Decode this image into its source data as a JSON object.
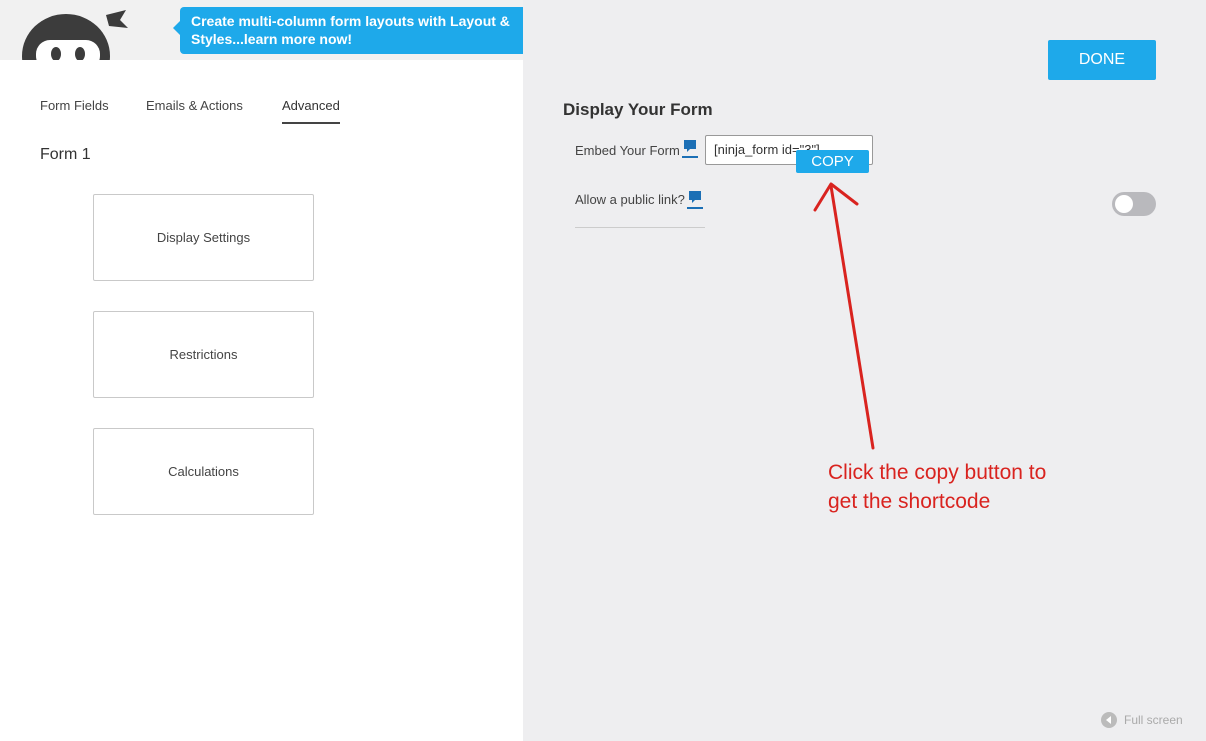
{
  "promo": {
    "line1": "Create multi-column form layouts with Layout &",
    "line2": "Styles...learn more now!"
  },
  "tabs": [
    {
      "label": "Form Fields",
      "active": false
    },
    {
      "label": "Emails & Actions",
      "active": false
    },
    {
      "label": "Advanced",
      "active": true
    }
  ],
  "form": {
    "title": "Form 1"
  },
  "cards": [
    {
      "label": "Display Settings"
    },
    {
      "label": "Restrictions"
    },
    {
      "label": "Calculations"
    }
  ],
  "header": {
    "done_label": "DONE"
  },
  "display": {
    "title": "Display Your Form",
    "embed_label": "Embed Your Form",
    "embed_value": "[ninja_form id=\"3\"]",
    "copy_label": "COPY",
    "public_link_label": "Allow a public link?",
    "public_link_enabled": false
  },
  "annotation": {
    "line1": "Click the copy button to",
    "line2": "get the shortcode"
  },
  "footer": {
    "fullscreen_label": "Full screen"
  },
  "icons": {
    "help": "speech-bubble-icon",
    "fullscreen": "circle-arrow-left-icon",
    "logo": "ninja-mascot-icon"
  },
  "colors": {
    "accent": "#1ea9ea",
    "annotation": "#d9231f",
    "help_icon": "#1b6fb5",
    "right_panel_bg": "#eeeef0"
  }
}
